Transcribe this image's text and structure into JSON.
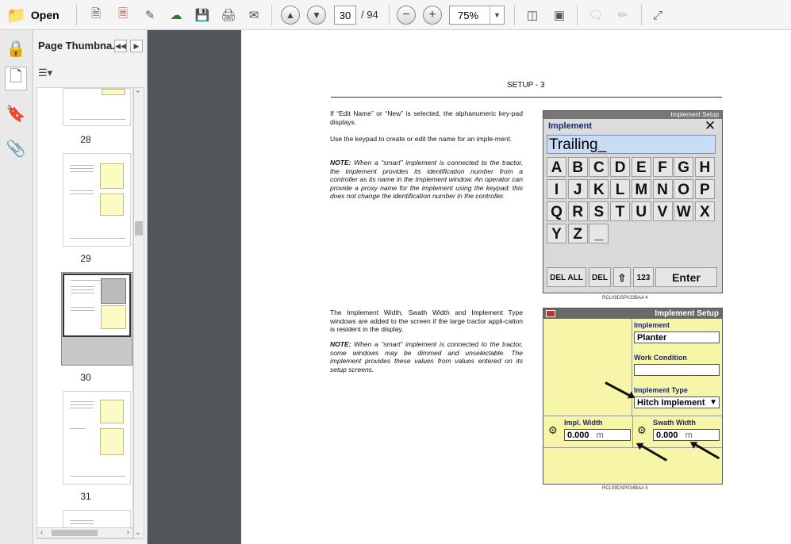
{
  "toolbar": {
    "open_label": "Open",
    "current_page": "30",
    "page_total": "/ 94",
    "zoom": "75%"
  },
  "thumbnails": {
    "title": "Page Thumbna...",
    "pages": [
      "28",
      "29",
      "30",
      "31"
    ]
  },
  "document": {
    "header": "SETUP - 3",
    "para1": "If “Edit Name” or “New” is selected, the alphanumeric key-pad displays.",
    "para2": "Use the keypad to create or edit the name for an imple-ment.",
    "note1_label": "NOTE:",
    "note1_text": "When a “smart” implement is connected to the tractor, the implement provides its identification number from a controller as its name in the Implement window. An operator can provide a proxy name for the implement using the keypad; this does not change the identification number in the controller.",
    "para3": "The Implement Width, Swath Width and Implement Type windows are added to the screen if the large tractor appli-cation is resident in the display.",
    "note2_label": "NOTE:",
    "note2_text": "When a “smart” implement is connected to the tractor, some windows may be dimmed and unselectable. The implement provides these values from values entered on its setup screens.",
    "figure1_caption": "RCL09DSP033BAA    4",
    "figure2_caption": "RCL09DSP034BAA    5"
  },
  "keypad": {
    "header": "Implement Setup",
    "title": "Implement",
    "close": "✕",
    "input_value": "Trailing_",
    "rows": [
      [
        "A",
        "B",
        "C",
        "D",
        "E",
        "F",
        "G",
        "H"
      ],
      [
        "I",
        "J",
        "K",
        "L",
        "M",
        "N",
        "O",
        "P"
      ],
      [
        "Q",
        "R",
        "S",
        "T",
        "U",
        "V",
        "W",
        "X"
      ],
      [
        "Y",
        "Z",
        "_"
      ]
    ],
    "del_all": "DEL ALL",
    "del": "DEL",
    "shift": "⇧",
    "num": "123",
    "enter": "Enter"
  },
  "setup_screen": {
    "title": "Implement Setup",
    "implement_label": "Implement",
    "implement_value": "Planter",
    "work_condition_label": "Work Condition",
    "work_condition_value": "",
    "implement_type_label": "Implement Type",
    "implement_type_value": "Hitch Implement",
    "impl_width_label": "Impl. Width",
    "impl_width_value": "0.000",
    "impl_width_unit": "m",
    "swath_width_label": "Swath Width",
    "swath_width_value": "0.000",
    "swath_width_unit": "m"
  }
}
